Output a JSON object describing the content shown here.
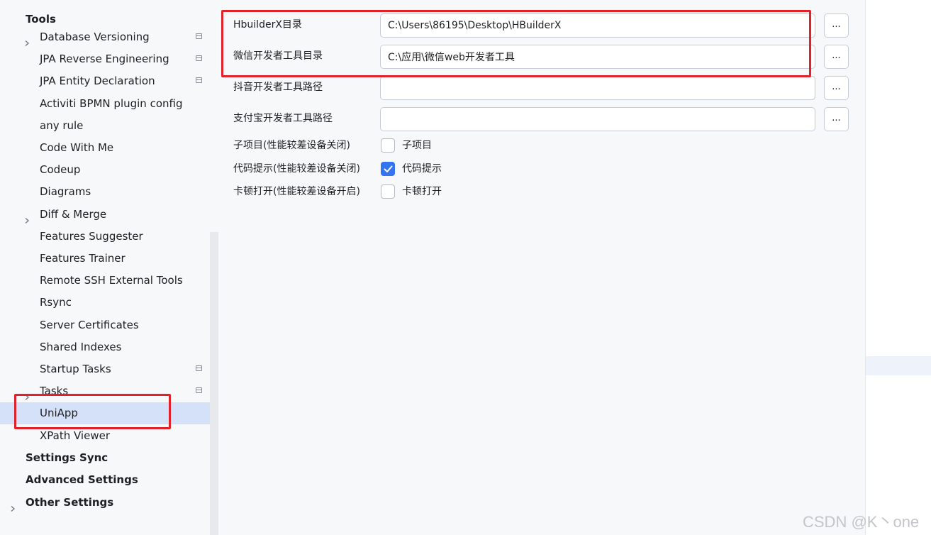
{
  "sidebar": {
    "section_title": "Tools",
    "items": [
      {
        "label": "Database Versioning",
        "chevron": true,
        "project_icon": true
      },
      {
        "label": "JPA Reverse Engineering",
        "chevron": false,
        "project_icon": true
      },
      {
        "label": "JPA Entity Declaration",
        "chevron": false,
        "project_icon": true
      },
      {
        "label": "Activiti BPMN plugin config",
        "chevron": false,
        "project_icon": false
      },
      {
        "label": "any rule",
        "chevron": false,
        "project_icon": false
      },
      {
        "label": "Code With Me",
        "chevron": false,
        "project_icon": false
      },
      {
        "label": "Codeup",
        "chevron": false,
        "project_icon": false
      },
      {
        "label": "Diagrams",
        "chevron": false,
        "project_icon": false
      },
      {
        "label": "Diff & Merge",
        "chevron": true,
        "project_icon": false
      },
      {
        "label": "Features Suggester",
        "chevron": false,
        "project_icon": false
      },
      {
        "label": "Features Trainer",
        "chevron": false,
        "project_icon": false
      },
      {
        "label": "Remote SSH External Tools",
        "chevron": false,
        "project_icon": false
      },
      {
        "label": "Rsync",
        "chevron": false,
        "project_icon": false
      },
      {
        "label": "Server Certificates",
        "chevron": false,
        "project_icon": false
      },
      {
        "label": "Shared Indexes",
        "chevron": false,
        "project_icon": false
      },
      {
        "label": "Startup Tasks",
        "chevron": false,
        "project_icon": true
      },
      {
        "label": "Tasks",
        "chevron": true,
        "project_icon": true
      },
      {
        "label": "UniApp",
        "chevron": false,
        "project_icon": false,
        "selected": true
      },
      {
        "label": "XPath Viewer",
        "chevron": false,
        "project_icon": false
      }
    ],
    "top_items": [
      {
        "label": "Settings Sync",
        "chevron": false
      },
      {
        "label": "Advanced Settings",
        "chevron": false
      },
      {
        "label": "Other Settings",
        "chevron": true
      }
    ]
  },
  "settings": {
    "paths": [
      {
        "label": "HbuilderX目录",
        "value": "C:\\Users\\86195\\Desktop\\HBuilderX",
        "browse": "..."
      },
      {
        "label": "微信开发者工具目录",
        "value": "C:\\应用\\微信web开发者工具",
        "browse": "..."
      },
      {
        "label": "抖音开发者工具路径",
        "value": "",
        "browse": "..."
      },
      {
        "label": "支付宝开发者工具路径",
        "value": "",
        "browse": "..."
      }
    ],
    "checkboxes": [
      {
        "label": "子项目(性能较差设备关闭)",
        "text": "子项目",
        "checked": false
      },
      {
        "label": "代码提示(性能较差设备关闭)",
        "text": "代码提示",
        "checked": true
      },
      {
        "label": "卡顿打开(性能较差设备开启)",
        "text": "卡顿打开",
        "checked": false
      }
    ]
  },
  "watermark": "CSDN @K丶one",
  "colors": {
    "selection": "#d5e1f8",
    "checkbox_checked": "#3574f0",
    "annotation_red": "#e0222b"
  }
}
